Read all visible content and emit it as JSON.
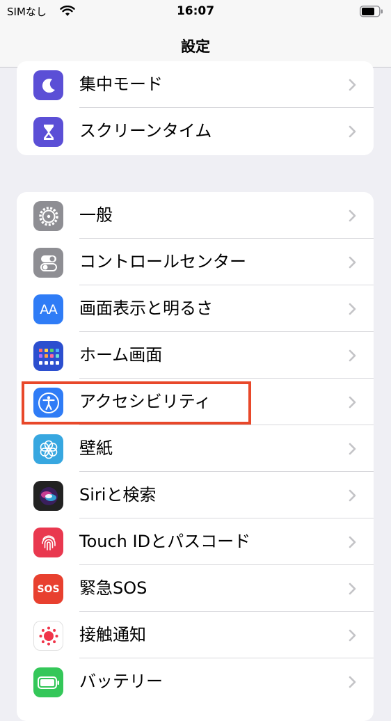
{
  "status_bar": {
    "carrier": "SIMなし",
    "time": "16:07"
  },
  "nav": {
    "title": "設定"
  },
  "group1": [
    {
      "label": "集中モード",
      "icon": "moon-icon",
      "color": "#5b4fd6"
    },
    {
      "label": "スクリーンタイム",
      "icon": "hourglass-icon",
      "color": "#5b4fd6"
    }
  ],
  "group2": [
    {
      "label": "一般",
      "icon": "gear-icon",
      "color": "#8e8e93"
    },
    {
      "label": "コントロールセンター",
      "icon": "toggles-icon",
      "color": "#8e8e93"
    },
    {
      "label": "画面表示と明るさ",
      "icon": "text-size-icon",
      "icon_text": "AA",
      "color": "#2f7cf6"
    },
    {
      "label": "ホーム画面",
      "icon": "home-grid-icon",
      "color": "#2c4fcf"
    },
    {
      "label": "アクセシビリティ",
      "icon": "accessibility-icon",
      "color": "#2f7cf6"
    },
    {
      "label": "壁紙",
      "icon": "flower-icon",
      "color": "#37a7e0"
    },
    {
      "label": "Siriと検索",
      "icon": "siri-icon",
      "color": "#222222"
    },
    {
      "label": "Touch IDとパスコード",
      "icon": "fingerprint-icon",
      "color": "#e9384f"
    },
    {
      "label": "緊急SOS",
      "icon": "sos-icon",
      "icon_text": "SOS",
      "color": "#e8402f"
    },
    {
      "label": "接触通知",
      "icon": "exposure-icon",
      "color": "#ffffff"
    },
    {
      "label": "バッテリー",
      "icon": "battery-setting-icon",
      "color": "#34c759"
    }
  ],
  "highlight": {
    "target": "アクセシビリティ",
    "color": "#e8482a"
  }
}
